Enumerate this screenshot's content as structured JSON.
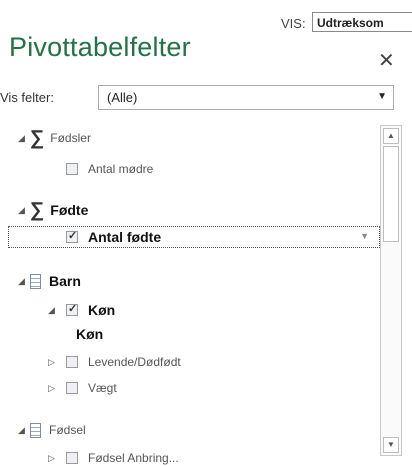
{
  "header": {
    "vis_label": "VIS:",
    "vis_value": "Udtræksom",
    "title": "Pivottabelfelter",
    "close_glyph": "✕"
  },
  "filter": {
    "label": "Vis felter:",
    "value": "(Alle)",
    "arrow": "▼"
  },
  "fields": {
    "fodsler": {
      "label": "Fødsler",
      "children": [
        {
          "label": "Antal mødre",
          "checked": false
        }
      ]
    },
    "fodte": {
      "label": "Fødte",
      "children": [
        {
          "label": "Antal fødte",
          "checked": true
        }
      ]
    },
    "barn": {
      "label": "Barn",
      "children": [
        {
          "label": "Køn",
          "checked": true,
          "sub": "Køn"
        },
        {
          "label": "Levende/Dødfødt",
          "checked": false
        },
        {
          "label": "Vægt",
          "checked": false
        }
      ]
    },
    "fodsel": {
      "label": "Fødsel",
      "partial": "Fødsel Anbring..."
    }
  },
  "icons": {
    "measure": "sigma-icon",
    "table": "table-icon",
    "expanded": "triangle-down-icon",
    "collapsed": "triangle-right-icon"
  },
  "colors": {
    "title": "#217346"
  }
}
